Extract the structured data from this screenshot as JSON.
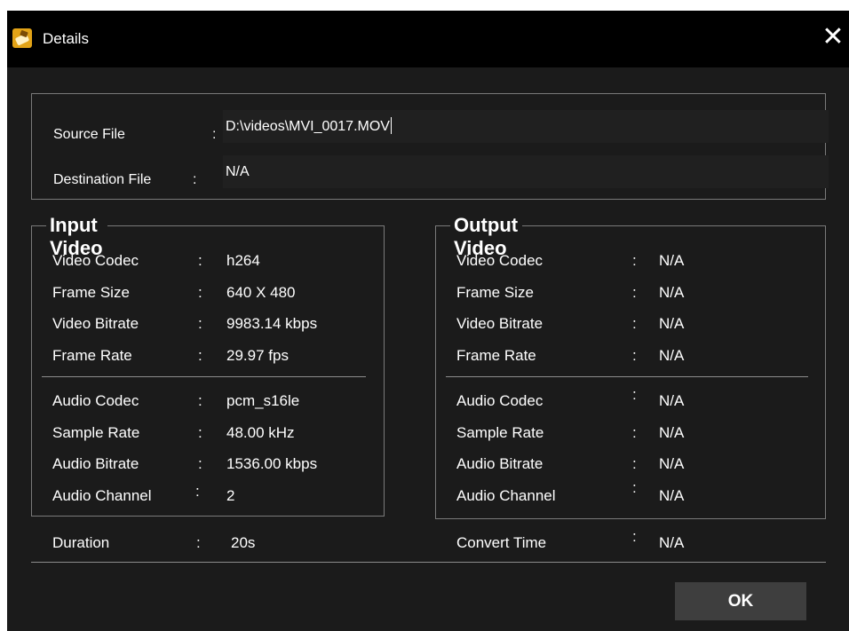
{
  "window": {
    "title": "Details",
    "close_symbol": "✕"
  },
  "files": {
    "source_label": "Source File",
    "source_value": "D:\\videos\\MVI_0017.MOV",
    "destination_label": "Destination File",
    "destination_value": "N/A",
    "separator": ":"
  },
  "input_video": {
    "heading": "Input Video",
    "video_rows": [
      {
        "label": "Video Codec",
        "value": "h264"
      },
      {
        "label": "Frame Size",
        "value": "640 X 480"
      },
      {
        "label": "Video Bitrate",
        "value": "9983.14 kbps"
      },
      {
        "label": "Frame Rate",
        "value": "29.97 fps"
      }
    ],
    "audio_rows": [
      {
        "label": "Audio Codec",
        "value": "pcm_s16le"
      },
      {
        "label": "Sample Rate",
        "value": "48.00 kHz"
      },
      {
        "label": "Audio Bitrate",
        "value": "1536.00 kbps"
      },
      {
        "label": "Audio Channel",
        "value": "2"
      }
    ],
    "duration_label": "Duration",
    "duration_value": "20s"
  },
  "output_video": {
    "heading": "Output Video",
    "video_rows": [
      {
        "label": "Video Codec",
        "value": "N/A"
      },
      {
        "label": "Frame Size",
        "value": "N/A"
      },
      {
        "label": "Video Bitrate",
        "value": "N/A"
      },
      {
        "label": "Frame Rate",
        "value": "N/A"
      }
    ],
    "audio_rows": [
      {
        "label": "Audio Codec",
        "value": "N/A"
      },
      {
        "label": "Sample Rate",
        "value": "N/A"
      },
      {
        "label": "Audio Bitrate",
        "value": "N/A"
      },
      {
        "label": "Audio Channel",
        "value": "N/A"
      }
    ],
    "convert_time_label": "Convert Time",
    "convert_time_value": "N/A"
  },
  "ok_label": "OK",
  "colors": {
    "titlebar": "#000000",
    "background": "#1b1b1b",
    "field": "#202020",
    "button": "#3e3e3e",
    "icon_accent": "#e2a317"
  }
}
